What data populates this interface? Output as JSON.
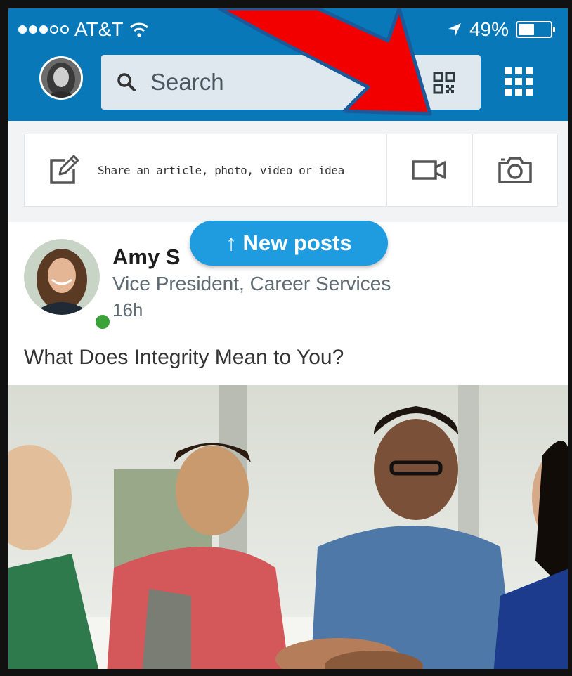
{
  "status_bar": {
    "carrier": "AT&T",
    "battery_percent": "49%",
    "battery_level": 0.49
  },
  "header": {
    "search_placeholder": "Search",
    "icons": [
      "profile-avatar",
      "search-icon",
      "qr-code-icon",
      "apps-grid-icon"
    ]
  },
  "share": {
    "prompt": "Share an article, photo, video or idea",
    "icons": [
      "compose-icon",
      "video-camera-icon",
      "camera-icon"
    ]
  },
  "new_posts": {
    "label": "↑ New posts"
  },
  "post": {
    "author_name": "Amy S",
    "author_title": "Vice President, Career Services",
    "time": "16h",
    "headline": "What Does Integrity Mean to You?"
  },
  "colors": {
    "header_blue": "#0878b8",
    "pill_blue": "#1f9be0",
    "annotation_red": "#f20000",
    "online_green": "#3aa337"
  }
}
